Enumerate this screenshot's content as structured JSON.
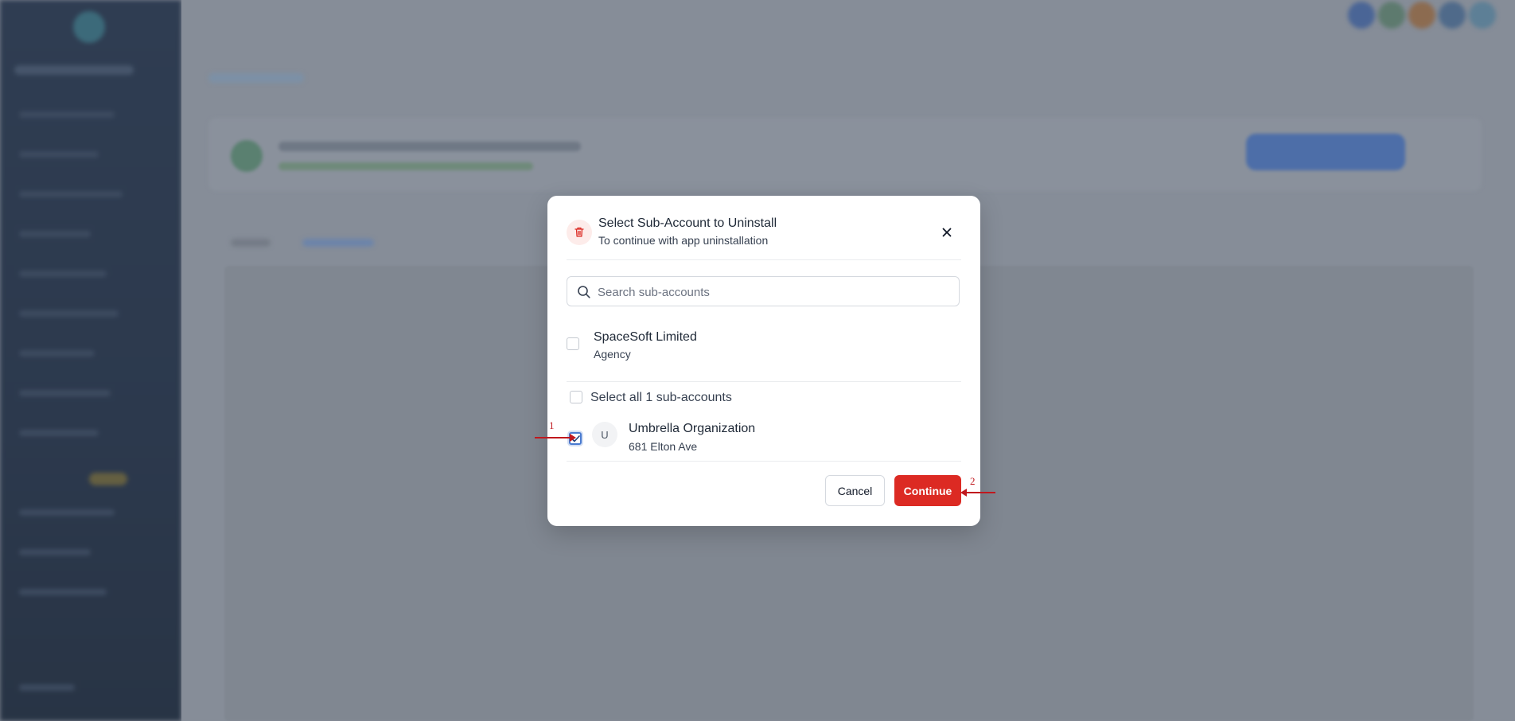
{
  "modal": {
    "title": "Select Sub-Account to Uninstall",
    "subtitle": "To continue with app uninstallation",
    "icons": {
      "header": "trash-icon",
      "close": "close-icon",
      "search": "search-icon",
      "check": "check-icon"
    },
    "search": {
      "placeholder": "Search sub-accounts",
      "value": ""
    },
    "agency": {
      "name": "SpaceSoft Limited",
      "type": "Agency",
      "checked": false
    },
    "select_all": {
      "label": "Select all 1 sub-accounts",
      "checked": false
    },
    "sub_accounts": [
      {
        "initial": "U",
        "name": "Umbrella Organization",
        "address": "681 Elton Ave",
        "checked": true
      }
    ],
    "buttons": {
      "cancel": "Cancel",
      "continue": "Continue"
    }
  },
  "annotations": [
    {
      "number": "1",
      "target": "sub-account checkbox"
    },
    {
      "number": "2",
      "target": "continue button"
    }
  ],
  "colors": {
    "danger": "#dc2a23",
    "checkbox_accent": "#4a7bd0",
    "annotation": "#c0181e",
    "overlay": "#7f8692"
  }
}
